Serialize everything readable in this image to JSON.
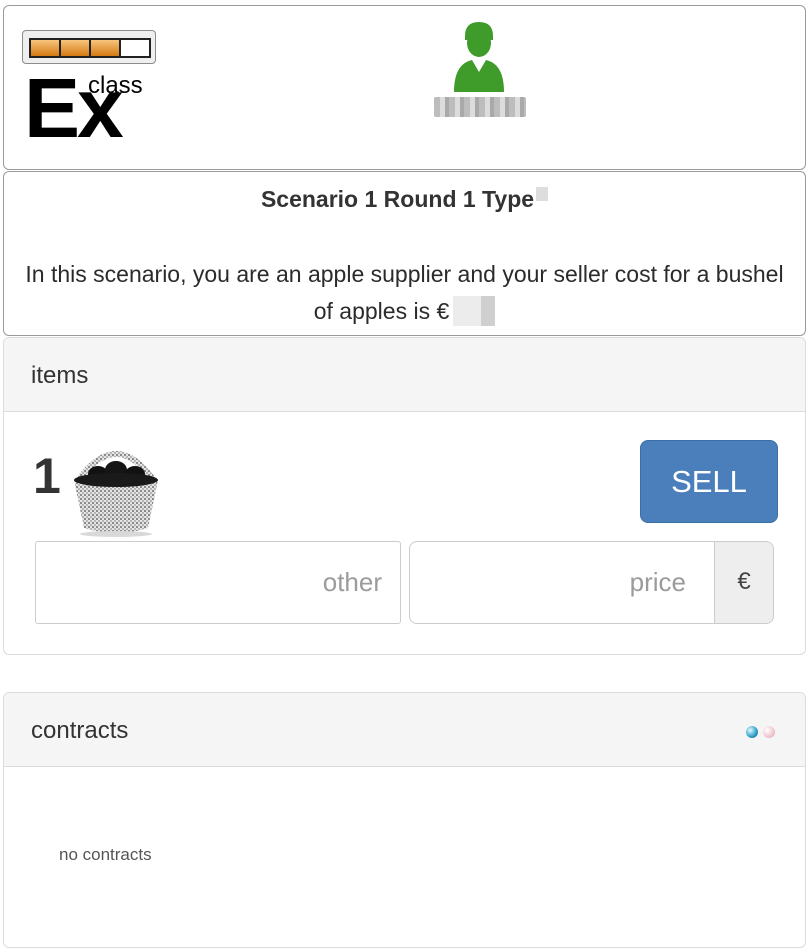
{
  "header": {
    "logo": {
      "battery_filled_cells": 3,
      "battery_total_cells": 4,
      "brand_main": "Ex",
      "brand_super": "class",
      "battery_color": "#e08a1e"
    },
    "user": {
      "icon": "user-avatar-icon",
      "avatar_color": "#3f9b2a",
      "name": ""
    }
  },
  "scenario": {
    "title": "Scenario 1 Round 1 Type",
    "description": "In this scenario, you are an apple supplier and your seller cost for a bushel of apples is €"
  },
  "items": {
    "heading": "items",
    "quantity": "1",
    "item_icon": "apple-basket-icon",
    "sell_label": "SELL",
    "other_placeholder": "other",
    "price_placeholder": "price",
    "currency": "€",
    "accent_color": "#4a7fbc"
  },
  "contracts": {
    "heading": "contracts",
    "status_indicators": [
      "blue-dot",
      "pink-dot"
    ],
    "empty_text": "no contracts"
  }
}
